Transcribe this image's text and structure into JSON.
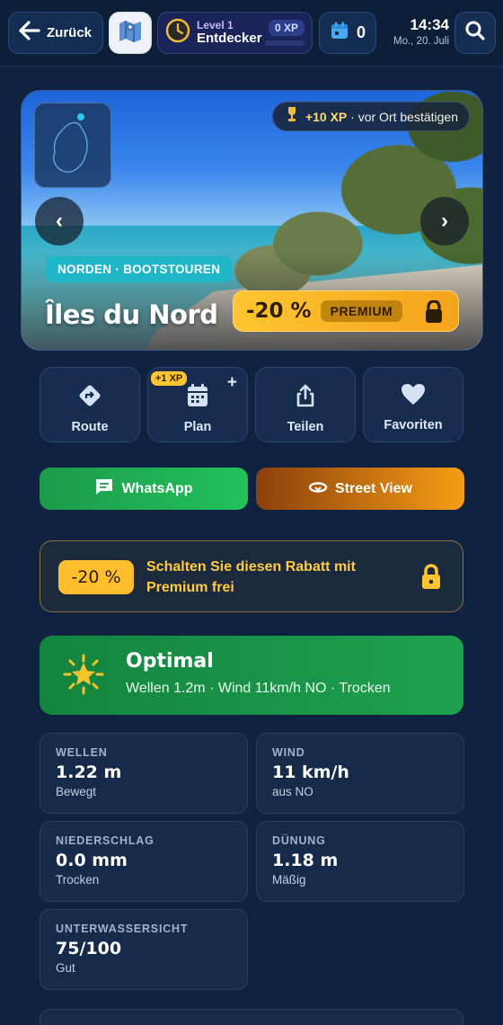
{
  "header": {
    "back_label": "Zurück",
    "level_label": "Level 1",
    "level_name": "Entdecker",
    "xp": "0 XP",
    "calendar_count": "0",
    "time": "14:34",
    "date": "Mo., 20. Juli"
  },
  "hero": {
    "xp_reward_amount": "+10 XP",
    "xp_reward_text": "· vor Ort bestätigen",
    "region": "NORDEN · BOOTSTOUREN",
    "title": "Îles du Nord",
    "discount": "-20 %",
    "premium_label": "PREMIUM",
    "prev_glyph": "‹",
    "next_glyph": "›"
  },
  "actions": {
    "route": "Route",
    "plan": "Plan",
    "plan_xp": "+1 XP",
    "share": "Teilen",
    "favorites": "Favoriten",
    "whatsapp": "WhatsApp",
    "street_view": "Street View"
  },
  "promo": {
    "discount": "-20 %",
    "text": "Schalten Sie diesen Rabatt mit Premium frei"
  },
  "condition": {
    "status": "Optimal",
    "summary": "Wellen 1.2m · Wind 11km/h NO · Trocken"
  },
  "stats": [
    {
      "label": "WELLEN",
      "value": "1.22 m",
      "sub": "Bewegt"
    },
    {
      "label": "WIND",
      "value": "11 km/h",
      "sub": "aus NO"
    },
    {
      "label": "NIEDERSCHLAG",
      "value": "0.0 mm",
      "sub": "Trocken"
    },
    {
      "label": "DÜNUNG",
      "value": "1.18 m",
      "sub": "Mäßig"
    },
    {
      "label": "UNTERWASSERSICHT",
      "value": "75/100",
      "sub": "Gut"
    }
  ],
  "colors": {
    "background": "#0f2340",
    "accent_gold": "#ffc531",
    "whatsapp_green": "#22c25c",
    "streetview_orange": "#f59e14",
    "condition_green": "#1ea14f",
    "region_teal": "#1fb6c8"
  },
  "icons": [
    "back-arrow-icon",
    "map-icon",
    "clock-icon",
    "calendar-icon",
    "search-icon",
    "trophy-icon",
    "route-icon",
    "calendar-plan-icon",
    "share-icon",
    "heart-icon",
    "chat-icon",
    "street-view-icon",
    "lock-icon",
    "sun-icon"
  ]
}
